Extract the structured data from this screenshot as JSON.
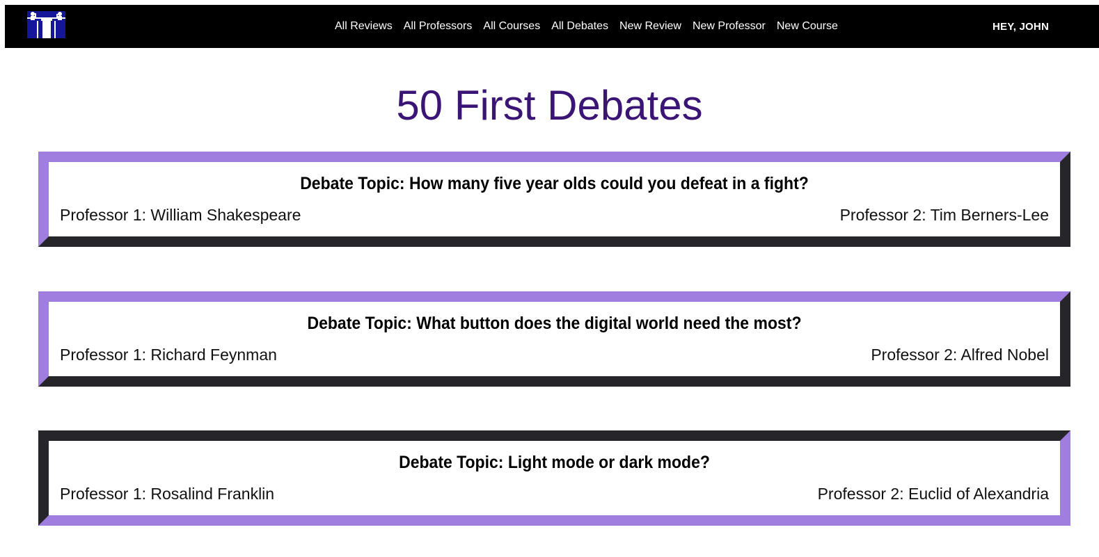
{
  "nav": {
    "logo": "debate-podium-logo",
    "links": [
      "All Reviews",
      "All Professors",
      "All Courses",
      "All Debates",
      "New Review",
      "New Professor",
      "New Course"
    ],
    "greeting": "HEY, JOHN"
  },
  "page": {
    "title": "50 First Debates"
  },
  "debates": [
    {
      "topic": "Debate Topic: How many five year olds could you defeat in a fight?",
      "professor1": "Professor 1: William Shakespeare",
      "professor2": "Professor 2: Tim Berners-Lee"
    },
    {
      "topic": "Debate Topic: What button does the digital world need the most?",
      "professor1": "Professor 1: Richard Feynman",
      "professor2": "Professor 2: Alfred Nobel"
    },
    {
      "topic": "Debate Topic: Light mode or dark mode?",
      "professor1": "Professor 1: Rosalind Franklin",
      "professor2": "Professor 2: Euclid of Alexandria"
    }
  ],
  "colors": {
    "title": "#3b1575",
    "card_border_light": "#a07ee0",
    "card_border_dark": "#72727e",
    "navbar": "#000000",
    "logo_blue": "#16169a"
  }
}
